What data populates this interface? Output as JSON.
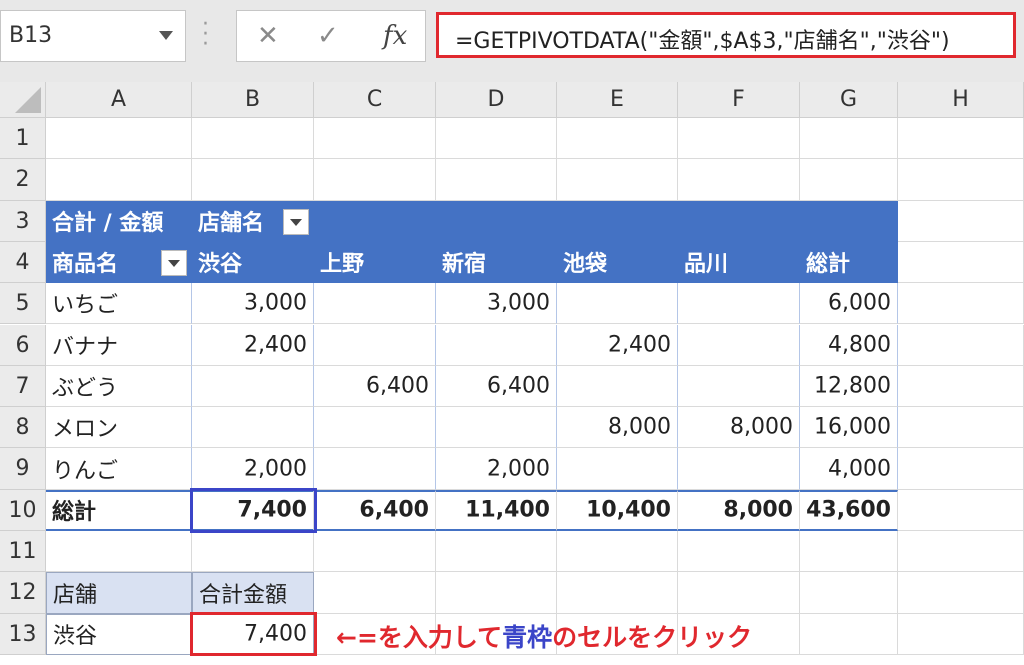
{
  "name_box": {
    "value": "B13"
  },
  "formula_bar": {
    "cancel": "✕",
    "enter": "✓",
    "fx": "fx",
    "formula": "=GETPIVOTDATA(\"金額\",$A$3,\"店舗名\",\"渋谷\")"
  },
  "columns": [
    "A",
    "B",
    "C",
    "D",
    "E",
    "F",
    "G",
    "H"
  ],
  "rows": [
    "1",
    "2",
    "3",
    "4",
    "5",
    "6",
    "7",
    "8",
    "9",
    "10",
    "11",
    "12",
    "13"
  ],
  "pivot": {
    "corner_label": "合計 / 金額",
    "column_field": "店舗名",
    "row_field": "商品名",
    "stores": [
      "渋谷",
      "上野",
      "新宿",
      "池袋",
      "品川",
      "総計"
    ],
    "items": [
      {
        "name": "いちご",
        "values": [
          "3,000",
          "",
          "3,000",
          "",
          "",
          "6,000"
        ]
      },
      {
        "name": "バナナ",
        "values": [
          "2,400",
          "",
          "",
          "2,400",
          "",
          "4,800"
        ]
      },
      {
        "name": "ぶどう",
        "values": [
          "",
          "6,400",
          "6,400",
          "",
          "",
          "12,800"
        ]
      },
      {
        "name": "メロン",
        "values": [
          "",
          "",
          "",
          "8,000",
          "8,000",
          "16,000"
        ]
      },
      {
        "name": "りんご",
        "values": [
          "2,000",
          "",
          "2,000",
          "",
          "",
          "4,000"
        ]
      }
    ],
    "total_label": "総計",
    "totals": [
      "7,400",
      "6,400",
      "11,400",
      "10,400",
      "8,000",
      "43,600"
    ]
  },
  "lookup": {
    "header_store": "店舗",
    "header_amount": "合計金額",
    "store": "渋谷",
    "amount": "7,400"
  },
  "annotation": {
    "part1": "←=を入力して",
    "part2": "青枠",
    "part3": "のセルをクリック"
  },
  "colors": {
    "pivot_header": "#4472c4",
    "highlight_red": "#e0282e",
    "highlight_blue": "#3b45c8",
    "light_header": "#d9e1f2"
  }
}
